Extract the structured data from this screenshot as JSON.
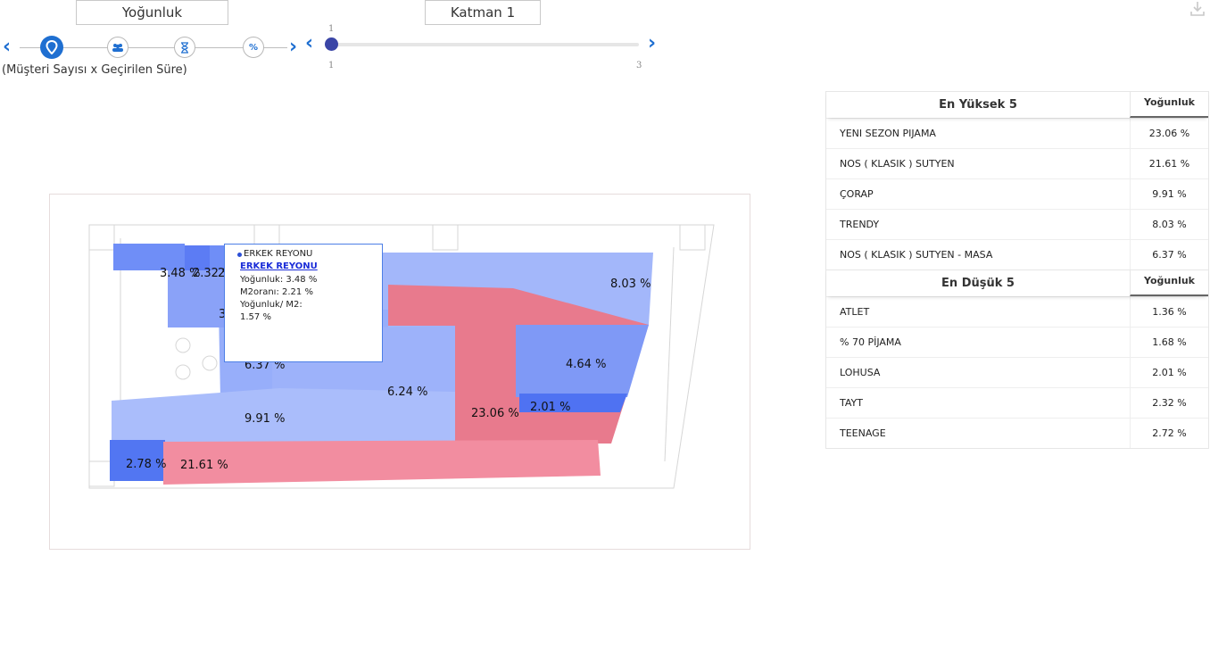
{
  "header": {
    "metric_button": "Yoğunluk",
    "layer_button": "Katman 1",
    "metric_subtitle": "(Müşteri Sayısı x Geçirilen Süre)",
    "steps": [
      {
        "icon": "location-pin-icon",
        "active": true
      },
      {
        "icon": "people-icon",
        "active": false
      },
      {
        "icon": "hourglass-icon",
        "active": false
      },
      {
        "icon": "percent-icon",
        "active": false
      }
    ],
    "slider": {
      "value_label": "1",
      "min_label": "1",
      "max_label": "3",
      "value": 1,
      "min": 1,
      "max": 3
    }
  },
  "map": {
    "zones": [
      {
        "name": "zone-3-48",
        "label": "3.48 %",
        "color": "#6f8ef7"
      },
      {
        "name": "zone-2-32",
        "label": "2.32 %",
        "color": "#5c7cf4"
      },
      {
        "name": "zone-2-72",
        "label": "2",
        "color": "#6f8ef7"
      },
      {
        "name": "zone-8-03",
        "label": "8.03 %",
        "color": "#a3b7fa"
      },
      {
        "name": "zone-3-x",
        "label": "3",
        "color": "#8aa2f8"
      },
      {
        "name": "zone-6-37",
        "label": "6.37 %",
        "color": "#97aefa"
      },
      {
        "name": "zone-6-24",
        "label": "6.24 %",
        "color": "#9db2fa"
      },
      {
        "name": "zone-9-91",
        "label": "9.91 %",
        "color": "#aabdfb"
      },
      {
        "name": "zone-23-06",
        "label": "23.06 %",
        "color": "#e87a8d"
      },
      {
        "name": "zone-4-64",
        "label": "4.64 %",
        "color": "#7f99f6"
      },
      {
        "name": "zone-2-01",
        "label": "2.01 %",
        "color": "#4f72f2"
      },
      {
        "name": "zone-2-78",
        "label": "2.78 %",
        "color": "#5276f2"
      },
      {
        "name": "zone-21-61",
        "label": "21.61 %",
        "color": "#f28da0"
      }
    ]
  },
  "tooltip": {
    "title": "ERKEK REYONU",
    "link": "ERKEK REYONU",
    "line1": "Yoğunluk: 3.48 %",
    "line2": "M2oranı: 2.21 %",
    "line3": "Yoğunluk/ M2:",
    "line4": "1.57 %"
  },
  "tables": {
    "top": {
      "title": "En Yüksek 5",
      "column": "Yoğunluk",
      "rows": [
        {
          "name": "YENI SEZON PIJAMA",
          "value": "23.06 %"
        },
        {
          "name": "NOS ( KLASIK ) SUTYEN",
          "value": "21.61 %"
        },
        {
          "name": "ÇORAP",
          "value": "9.91 %"
        },
        {
          "name": "TRENDY",
          "value": "8.03 %"
        },
        {
          "name": "NOS ( KLASIK ) SUTYEN - MASA",
          "value": "6.37 %"
        }
      ]
    },
    "bottom": {
      "title": "En Düşük 5",
      "column": "Yoğunluk",
      "rows": [
        {
          "name": "ATLET",
          "value": "1.36 %"
        },
        {
          "name": "% 70 PİJAMA",
          "value": "1.68 %"
        },
        {
          "name": "LOHUSA",
          "value": "2.01 %"
        },
        {
          "name": "TAYT",
          "value": "2.32 %"
        },
        {
          "name": "TEENAGE",
          "value": "2.72 %"
        }
      ]
    }
  },
  "icons": {
    "prev": "chevron-left-icon",
    "next": "chevron-right-icon",
    "download": "download-icon"
  }
}
